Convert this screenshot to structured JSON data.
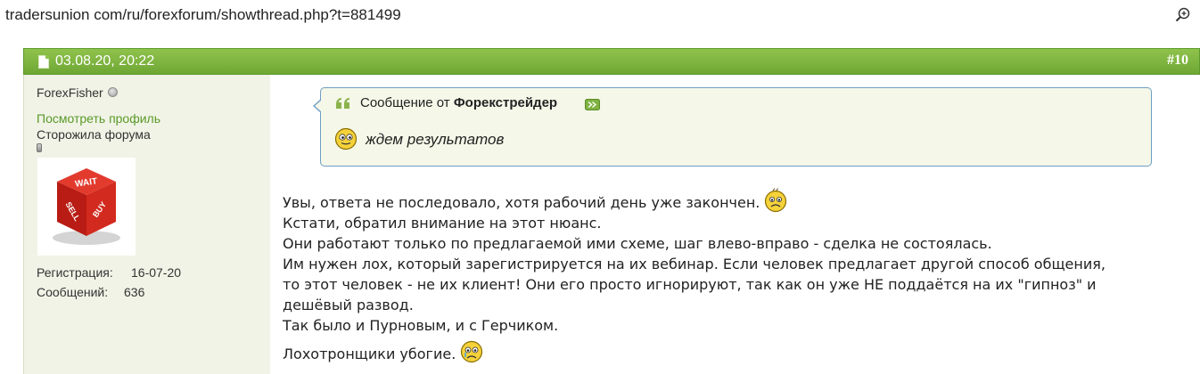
{
  "url": "tradersunion com/ru/forexforum/showthread.php?t=881499",
  "post": {
    "date": "03.08.20, 20:22",
    "number": "#10"
  },
  "user": {
    "name": "ForexFisher",
    "profile_link": "Посмотреть профиль",
    "title": "Сторожила форума",
    "reg_label": "Регистрация:",
    "reg_value": "16-07-20",
    "msgs_label": "Сообщений:",
    "msgs_value": "636",
    "avatar_text": [
      "WAIT",
      "SELL",
      "BUY"
    ]
  },
  "quote": {
    "prefix": "Сообщение от",
    "author": "Форекстрейдер",
    "text": "ждем результатов"
  },
  "body": {
    "lines": [
      "Увы, ответа не последовало, хотя рабочий день уже закончен.",
      "Кстати, обратил внимание на этот нюанс.",
      "Они работают только по предлагаемой ими схеме, шаг влево-вправо - сделка не состоялась.",
      "Им нужен лох, который зарегистрируется на их вебинар. Если человек предлагает другой способ общения,",
      "то этот человек - не их клиент! Они его просто игнорируют, так как он уже НЕ поддаётся на их \"гипноз\" и",
      "дешёвый развод.",
      "Так было и Пурновым, и с Герчиком.",
      "Лохотронщики убогие."
    ]
  },
  "icons": {
    "zoom": "zoom-in-icon",
    "doc": "document-icon",
    "quote": "quote-icon",
    "view_post": "view-post-icon",
    "smiley_quote": "smiley-wink-icon",
    "smiley_sad": "smiley-sad-icon",
    "smiley_cry": "smiley-cry-icon"
  },
  "colors": {
    "header_green": "#7bb43c",
    "link_green": "#5a9a2a",
    "sidebar_bg": "#f1f3e6",
    "quote_border": "#6f9ec4"
  }
}
